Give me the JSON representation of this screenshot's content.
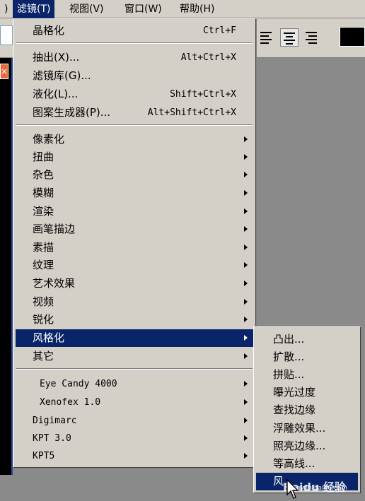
{
  "menubar": {
    "items": [
      {
        "label": ")"
      },
      {
        "label": "滤镜(T)"
      },
      {
        "label": "视图(V)"
      },
      {
        "label": "窗口(W)"
      },
      {
        "label": "帮助(H)"
      }
    ]
  },
  "filter_menu": {
    "items": [
      {
        "label": "晶格化",
        "shortcut": "Ctrl+F"
      },
      {
        "label": "抽出(X)...",
        "shortcut": "Alt+Ctrl+X"
      },
      {
        "label": "滤镜库(G)..."
      },
      {
        "label": "液化(L)...",
        "shortcut": "Shift+Ctrl+X"
      },
      {
        "label": "图案生成器(P)...",
        "shortcut": "Alt+Shift+Ctrl+X"
      },
      {
        "label": "像素化"
      },
      {
        "label": "扭曲"
      },
      {
        "label": "杂色"
      },
      {
        "label": "模糊"
      },
      {
        "label": "渲染"
      },
      {
        "label": "画笔描边"
      },
      {
        "label": "素描"
      },
      {
        "label": "纹理"
      },
      {
        "label": "艺术效果"
      },
      {
        "label": "视频"
      },
      {
        "label": "锐化"
      },
      {
        "label": "风格化"
      },
      {
        "label": "其它"
      },
      {
        "label": "Eye Candy 4000"
      },
      {
        "label": "Xenofex 1.0"
      },
      {
        "label": "Digimarc"
      },
      {
        "label": "KPT 3.0"
      },
      {
        "label": "KPT5"
      }
    ]
  },
  "stylize_submenu": {
    "items": [
      {
        "label": "凸出..."
      },
      {
        "label": "扩散..."
      },
      {
        "label": "拼贴..."
      },
      {
        "label": "曝光过度"
      },
      {
        "label": "查找边缘"
      },
      {
        "label": "浮雕效果..."
      },
      {
        "label": "照亮边缘..."
      },
      {
        "label": "等高线..."
      },
      {
        "label": "风"
      }
    ]
  },
  "document": {
    "close_glyph": "×"
  },
  "watermark": {
    "logo": "Baidu 经验",
    "url": "jingyan.baidu.com"
  },
  "colors": {
    "highlight": "#0a246a",
    "menu_bg": "#d4d0c8",
    "swatch": "#000000"
  }
}
